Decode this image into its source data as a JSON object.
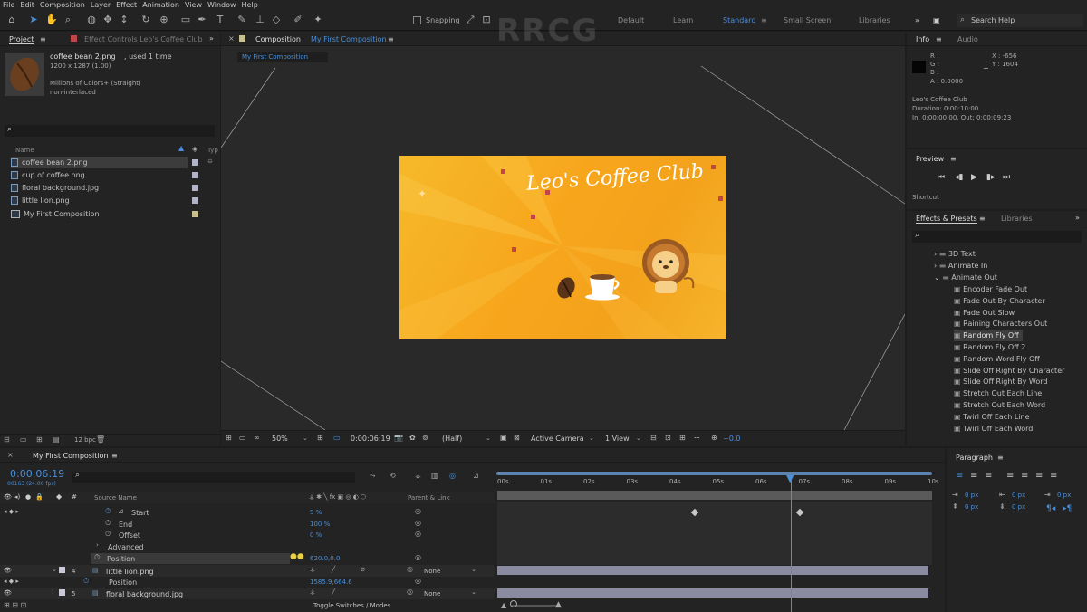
{
  "menu": [
    "File",
    "Edit",
    "Composition",
    "Layer",
    "Effect",
    "Animation",
    "View",
    "Window",
    "Help"
  ],
  "toolbar": {
    "snapping_label": "Snapping",
    "workspaces": [
      "Default",
      "Learn",
      "Standard",
      "Small Screen",
      "Libraries"
    ],
    "active_workspace": "Standard",
    "search_placeholder": "Search Help"
  },
  "project": {
    "tab": "Project",
    "effect_controls_tab": "Effect Controls Leo's Coffee Club",
    "selected": {
      "name": "coffee bean 2.png",
      "used": ", used 1 time",
      "dims": "1200 x 1287 (1.00)",
      "colors": "Millions of Colors+ (Straight)",
      "interlace": "non-interlaced"
    },
    "search_placeholder": "",
    "col_name": "Name",
    "col_type": "Typ",
    "items": [
      "coffee bean 2.png",
      "cup of coffee.png",
      "floral background.jpg",
      "little lion.png",
      "My First Composition"
    ],
    "bpc": "12 bpc"
  },
  "composition": {
    "tab_prefix": "Composition",
    "tab_name": "My First Composition",
    "breadcrumb": "My First Composition",
    "title_text": "Leo's Coffee Club",
    "zoom": "50%",
    "timecode": "0:00:06:19",
    "resolution": "(Half)",
    "camera": "Active Camera",
    "views": "1 View",
    "exposure": "+0.0"
  },
  "info": {
    "tab": "Info",
    "audio_tab": "Audio",
    "r": "R :",
    "g": "G :",
    "b": "B :",
    "a": "A : 0.0000",
    "x": "X : -656",
    "y": "Y : 1604",
    "comp_name": "Leo's Coffee Club",
    "duration": "Duration: 0:00:10:00",
    "inout": "In: 0:00:00:00, Out: 0:00:09:23"
  },
  "preview": {
    "tab": "Preview",
    "shortcut": "Shortcut"
  },
  "effects": {
    "tab": "Effects & Presets",
    "libraries_tab": "Libraries",
    "folders": [
      "3D Text",
      "Animate In",
      "Animate Out"
    ],
    "presets": [
      "Encoder Fade Out",
      "Fade Out By Character",
      "Fade Out Slow",
      "Raining Characters Out",
      "Random Fly Off",
      "Random Fly Off 2",
      "Random Word Fly Off",
      "Slide Off Right By Character",
      "Slide Off Right By Word",
      "Stretch Out Each Line",
      "Stretch Out Each Word",
      "Twirl Off Each Line",
      "Twirl Off Each Word"
    ],
    "selected": "Random Fly Off"
  },
  "paragraph": {
    "tab": "Paragraph",
    "vals": [
      "0 px",
      "0 px",
      "0 px",
      "0 px",
      "0 px"
    ]
  },
  "timeline": {
    "tab": "My First Composition",
    "timecode": "0:00:06:19",
    "frames": "00163 (24.00 fps)",
    "col_source": "Source Name",
    "col_parent": "Parent & Link",
    "ticks": [
      "00s",
      "01s",
      "02s",
      "03s",
      "04s",
      "05s",
      "06s",
      "07s",
      "08s",
      "09s",
      "10s"
    ],
    "props": [
      {
        "name": "Start",
        "value": "9 %"
      },
      {
        "name": "End",
        "value": "100 %"
      },
      {
        "name": "Offset",
        "value": "0 %"
      },
      {
        "name": "Advanced",
        "value": ""
      },
      {
        "name": "Position",
        "value": "620.0,0.0"
      }
    ],
    "layers": [
      {
        "num": "4",
        "name": "little lion.png",
        "parent": "None"
      },
      {
        "num": "",
        "name": "Position",
        "value": "1585.9,664.6"
      },
      {
        "num": "5",
        "name": "floral background.jpg",
        "parent": "None"
      }
    ],
    "toggle": "Toggle Switches / Modes"
  },
  "watermark": "RRCG"
}
